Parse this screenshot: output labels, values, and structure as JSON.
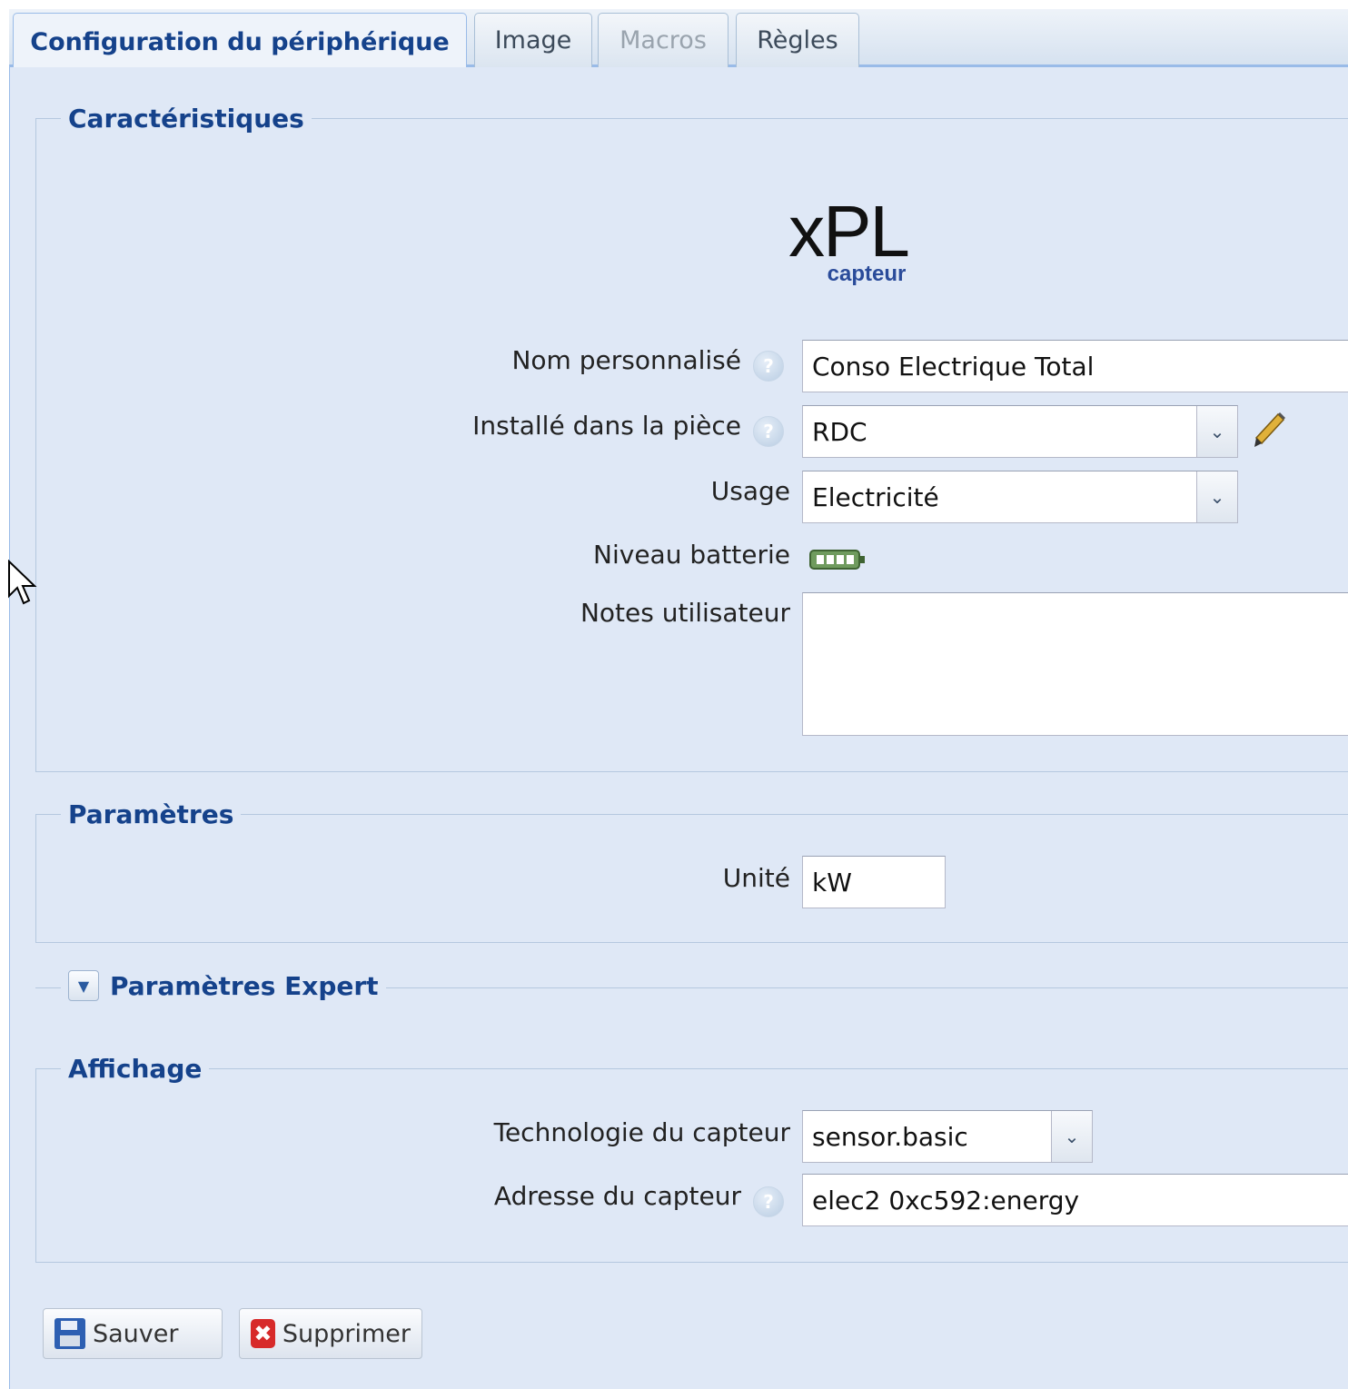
{
  "tabs": [
    {
      "label": "Configuration du périphérique",
      "state": "active"
    },
    {
      "label": "Image",
      "state": "normal"
    },
    {
      "label": "Macros",
      "state": "disabled"
    },
    {
      "label": "Règles",
      "state": "normal"
    }
  ],
  "logo": {
    "main": "xPL",
    "sub": "capteur"
  },
  "characteristics": {
    "legend": "Caractéristiques",
    "custom_name_label": "Nom personnalisé",
    "custom_name_value": "Conso Electrique Total",
    "room_label": "Installé dans la pièce",
    "room_value": "RDC",
    "usage_label": "Usage",
    "usage_value": "Electricité",
    "battery_label": "Niveau batterie",
    "battery_level_fraction": 1.0,
    "notes_label": "Notes utilisateur",
    "notes_value": ""
  },
  "parameters": {
    "legend": "Paramètres",
    "unit_label": "Unité",
    "unit_value": "kW"
  },
  "expert": {
    "legend": "Paramètres Expert"
  },
  "display": {
    "legend": "Affichage",
    "tech_label": "Technologie du capteur",
    "tech_value": "sensor.basic",
    "address_label": "Adresse du capteur",
    "address_value": "elec2 0xc592:energy"
  },
  "buttons": {
    "save": "Sauver",
    "delete": "Supprimer"
  },
  "icons": [
    "help-icon",
    "chevron-down-icon",
    "pencil-icon",
    "battery-icon",
    "collapse-toggle-icon",
    "save-icon",
    "delete-icon",
    "mouse-cursor-icon"
  ],
  "colors": {
    "panel_bg": "#dfe8f6",
    "legend_text": "#15428b",
    "border": "#99bbe8"
  }
}
